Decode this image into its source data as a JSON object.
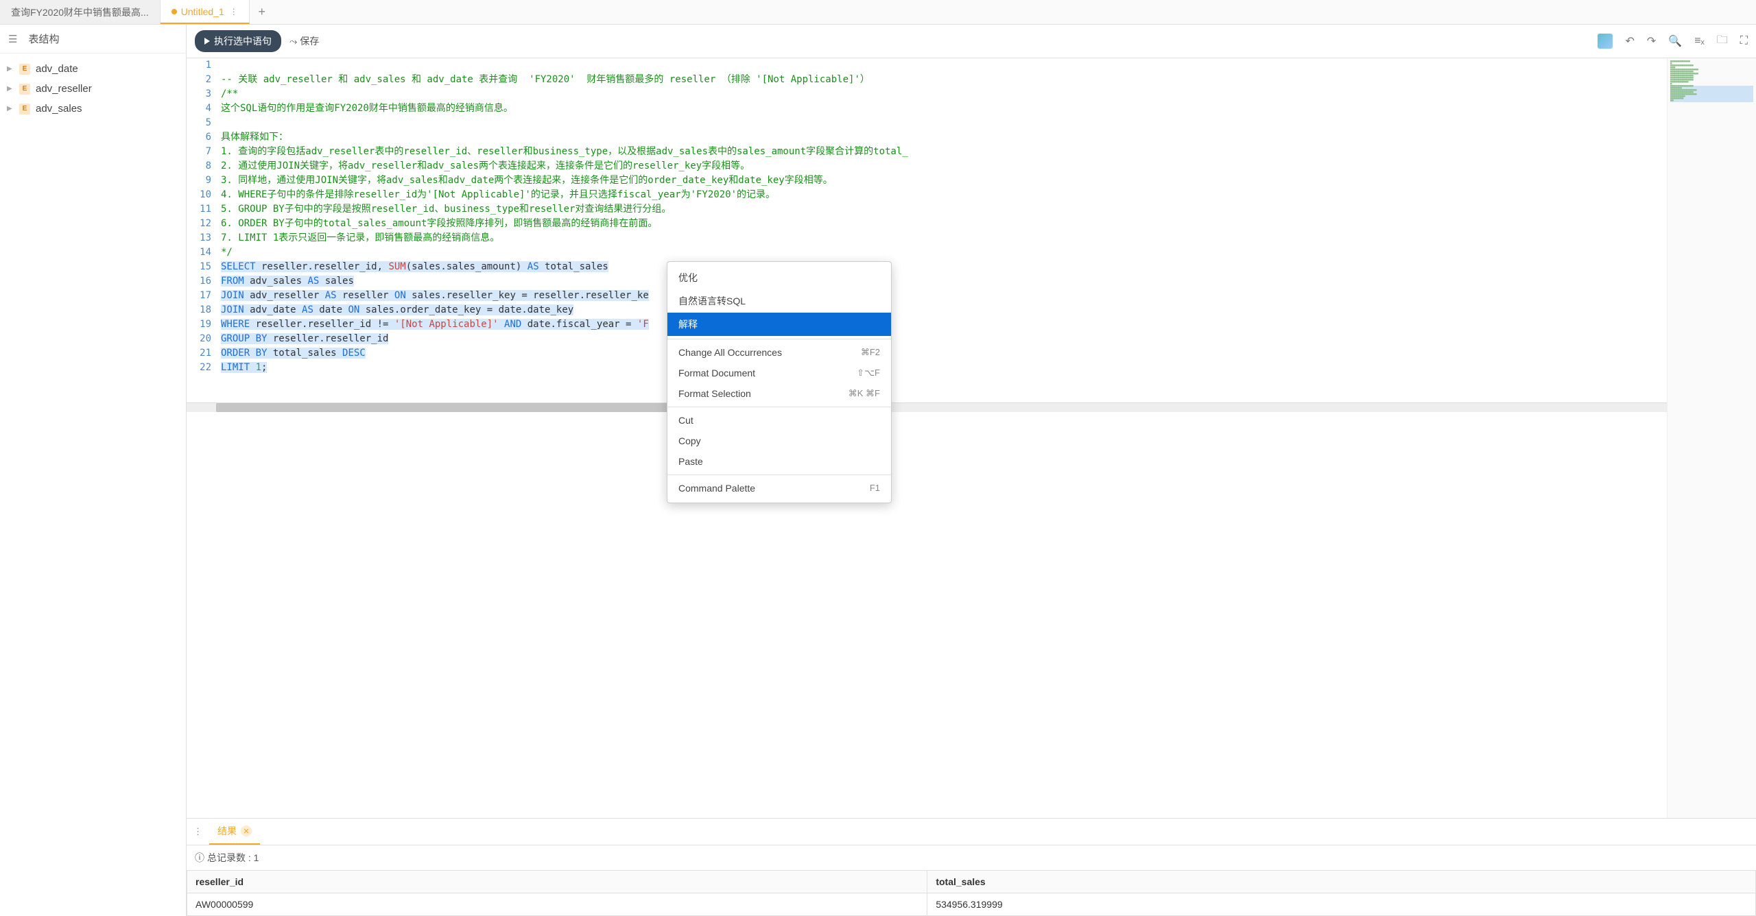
{
  "tabs": {
    "inactive": "查询FY2020财年中销售额最高...",
    "active": "Untitled_1"
  },
  "sidebar": {
    "header": "表结构",
    "items": [
      {
        "label": "adv_date"
      },
      {
        "label": "adv_reseller"
      },
      {
        "label": "adv_sales"
      }
    ]
  },
  "toolbar": {
    "run": "执行选中语句",
    "save": "保存"
  },
  "code": {
    "l2": "-- 关联 adv_reseller 和 adv_sales 和 adv_date 表并查询  'FY2020'  财年销售额最多的 reseller （排除 '[Not Applicable]'）",
    "l3": "/**",
    "l4": "这个SQL语句的作用是查询FY2020财年中销售额最高的经销商信息。",
    "l6": "具体解释如下：",
    "l7": "1. 查询的字段包括adv_reseller表中的reseller_id、reseller和business_type，以及根据adv_sales表中的sales_amount字段聚合计算的total_",
    "l8": "2. 通过使用JOIN关键字，将adv_reseller和adv_sales两个表连接起来，连接条件是它们的reseller_key字段相等。",
    "l9": "3. 同样地，通过使用JOIN关键字，将adv_sales和adv_date两个表连接起来，连接条件是它们的order_date_key和date_key字段相等。",
    "l10": "4. WHERE子句中的条件是排除reseller_id为'[Not Applicable]'的记录，并且只选择fiscal_year为'FY2020'的记录。",
    "l11": "5. GROUP BY子句中的字段是按照reseller_id、business_type和reseller对查询结果进行分组。",
    "l12": "6. ORDER BY子句中的total_sales_amount字段按照降序排列，即销售额最高的经销商排在前面。",
    "l13": "7. LIMIT 1表示只返回一条记录，即销售额最高的经销商信息。",
    "l14": "*/",
    "kw_select": "SELECT",
    "sel_cols": " reseller.reseller_id, ",
    "fn_sum": "SUM",
    "sum_arg": "(sales.sales_amount) ",
    "kw_as": "AS",
    "alias_total": " total_sales",
    "kw_from": "FROM",
    "from_rest": " adv_sales ",
    "alias_sales": " sales",
    "kw_join": "JOIN",
    "join1_rest": " adv_reseller ",
    "alias_reseller": " reseller ",
    "kw_on": "ON",
    "on1": " sales.reseller_key = reseller.reseller_ke",
    "join2_rest": " adv_date ",
    "alias_date": " date ",
    "on2": " sales.order_date_key = date.date_key",
    "kw_where": "WHERE",
    "where1": " reseller.reseller_id != ",
    "str_na": "'[Not Applicable]'",
    "kw_and": " AND ",
    "where2": "date.fiscal_year = ",
    "str_fy": "'F",
    "kw_group": "GROUP BY",
    "group_rest": " reseller.reseller_id",
    "kw_order": "ORDER BY",
    "order_rest": " total_sales ",
    "kw_desc": "DESC",
    "kw_limit": "LIMIT",
    "limit_sp": " ",
    "limit_num": "1",
    "semicolon": ";"
  },
  "context_menu": {
    "optimize": "优化",
    "nl2sql": "自然语言转SQL",
    "explain": "解释",
    "change_all": "Change All Occurrences",
    "change_all_sc": "⌘F2",
    "format_doc": "Format Document",
    "format_doc_sc": "⇧⌥F",
    "format_sel": "Format Selection",
    "format_sel_sc": "⌘K ⌘F",
    "cut": "Cut",
    "copy": "Copy",
    "paste": "Paste",
    "cmd_palette": "Command Palette",
    "cmd_palette_sc": "F1"
  },
  "results": {
    "tab_label": "结果",
    "total_label": "总记录数 : 1",
    "columns": [
      "reseller_id",
      "total_sales"
    ],
    "rows": [
      {
        "reseller_id": "AW00000599",
        "total_sales": "534956.319999"
      }
    ]
  }
}
